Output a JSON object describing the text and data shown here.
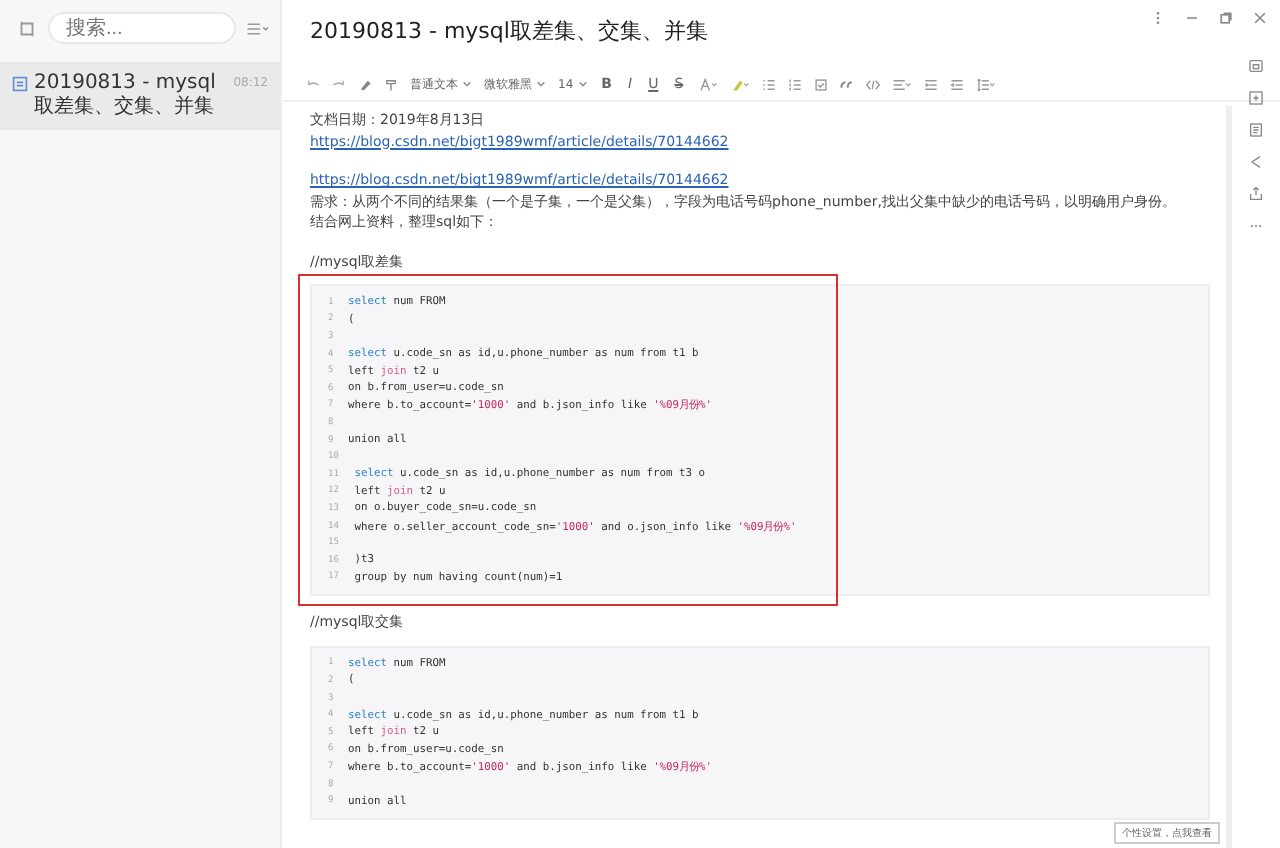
{
  "sidebar": {
    "search": {
      "placeholder": "搜索..."
    },
    "items": [
      {
        "title": "20190813 - mysql取差集、交集、并集",
        "time": "08:12",
        "selected": true
      }
    ]
  },
  "document": {
    "title": "20190813 - mysql取差集、交集、并集"
  },
  "toolbar": {
    "style_dropdown": "普通文本",
    "font_dropdown": "微软雅黑",
    "size_dropdown": "14",
    "format_buttons": [
      "B",
      "I",
      "U",
      "S"
    ]
  },
  "content": [
    {
      "kind": "text",
      "text": "文档日期：2019年8月13日"
    },
    {
      "kind": "link",
      "text": "https://blog.csdn.net/bigt1989wmf/article/details/70144662"
    },
    {
      "kind": "blank"
    },
    {
      "kind": "link",
      "text": "https://blog.csdn.net/bigt1989wmf/article/details/70144662"
    },
    {
      "kind": "text",
      "text": "需求：从两个不同的结果集（一个是子集，一个是父集），字段为电话号码phone_number,找出父集中缺少的电话号码，以明确用户身份。"
    },
    {
      "kind": "text",
      "text": "结合网上资料，整理sql如下："
    },
    {
      "kind": "blank"
    },
    {
      "kind": "text",
      "text": "//mysql取差集"
    },
    {
      "kind": "code",
      "highlighted": true,
      "lines": [
        {
          "num": "1",
          "tokens": [
            {
              "text": "select",
              "kind": "keyword"
            },
            {
              "text": " num FROM",
              "kind": "plain"
            }
          ]
        },
        {
          "num": "2",
          "tokens": [
            {
              "text": "(",
              "kind": "plain"
            }
          ]
        },
        {
          "num": "3"
        },
        {
          "num": "4",
          "tokens": [
            {
              "text": "select",
              "kind": "keyword"
            },
            {
              "text": " u.code_sn as id,u.phone_number as num from t1 b",
              "kind": "plain"
            }
          ]
        },
        {
          "num": "5",
          "tokens": [
            {
              "text": "left ",
              "kind": "plain"
            },
            {
              "text": "join",
              "kind": "join"
            },
            {
              "text": " t2 u",
              "kind": "plain"
            }
          ]
        },
        {
          "num": "6",
          "tokens": [
            {
              "text": "on b.from_user=u.code_sn",
              "kind": "plain"
            }
          ]
        },
        {
          "num": "7",
          "tokens": [
            {
              "text": "where b.to_account=",
              "kind": "plain"
            },
            {
              "text": "'1000'",
              "kind": "string"
            },
            {
              "text": " and b.json_info like ",
              "kind": "plain"
            },
            {
              "text": "'%09月份%'",
              "kind": "string"
            }
          ]
        },
        {
          "num": "8"
        },
        {
          "num": "9",
          "tokens": [
            {
              "text": "union all",
              "kind": "plain"
            }
          ]
        },
        {
          "num": "10"
        },
        {
          "num": "11",
          "tokens": [
            {
              "text": " select",
              "kind": "keyword"
            },
            {
              "text": " u.code_sn as id,u.phone_number as num from t3 o",
              "kind": "plain"
            }
          ]
        },
        {
          "num": "12",
          "tokens": [
            {
              "text": " left ",
              "kind": "plain"
            },
            {
              "text": "join",
              "kind": "join"
            },
            {
              "text": " t2 u",
              "kind": "plain"
            }
          ]
        },
        {
          "num": "13",
          "tokens": [
            {
              "text": " on o.buyer_code_sn=u.code_sn",
              "kind": "plain"
            }
          ]
        },
        {
          "num": "14",
          "tokens": [
            {
              "text": " where o.seller_account_code_sn=",
              "kind": "plain"
            },
            {
              "text": "'1000'",
              "kind": "string"
            },
            {
              "text": " and o.json_info like ",
              "kind": "plain"
            },
            {
              "text": "'%09月份%'",
              "kind": "string"
            }
          ]
        },
        {
          "num": "15"
        },
        {
          "num": "16",
          "tokens": [
            {
              "text": " )t3",
              "kind": "plain"
            }
          ]
        },
        {
          "num": "17",
          "tokens": [
            {
              "text": " group by num having count(num)=1",
              "kind": "plain"
            }
          ]
        }
      ]
    },
    {
      "kind": "text",
      "text": "//mysql取交集"
    },
    {
      "kind": "code",
      "highlighted": false,
      "lines": [
        {
          "num": "1",
          "tokens": [
            {
              "text": "select",
              "kind": "keyword"
            },
            {
              "text": " num FROM",
              "kind": "plain"
            }
          ]
        },
        {
          "num": "2",
          "tokens": [
            {
              "text": "(",
              "kind": "plain"
            }
          ]
        },
        {
          "num": "3"
        },
        {
          "num": "4",
          "tokens": [
            {
              "text": "select",
              "kind": "keyword"
            },
            {
              "text": " u.code_sn as id,u.phone_number as num from t1 b",
              "kind": "plain"
            }
          ]
        },
        {
          "num": "5",
          "tokens": [
            {
              "text": "left ",
              "kind": "plain"
            },
            {
              "text": "join",
              "kind": "join"
            },
            {
              "text": " t2 u",
              "kind": "plain"
            }
          ]
        },
        {
          "num": "6",
          "tokens": [
            {
              "text": "on b.from_user=u.code_sn",
              "kind": "plain"
            }
          ]
        },
        {
          "num": "7",
          "tokens": [
            {
              "text": "where b.to_account=",
              "kind": "plain"
            },
            {
              "text": "'1000'",
              "kind": "string"
            },
            {
              "text": " and b.json_info like ",
              "kind": "plain"
            },
            {
              "text": "'%09月份%'",
              "kind": "string"
            }
          ]
        },
        {
          "num": "8"
        },
        {
          "num": "9",
          "tokens": [
            {
              "text": "union all",
              "kind": "plain"
            }
          ]
        }
      ]
    }
  ],
  "tooltip": "个性设置，点我查看"
}
